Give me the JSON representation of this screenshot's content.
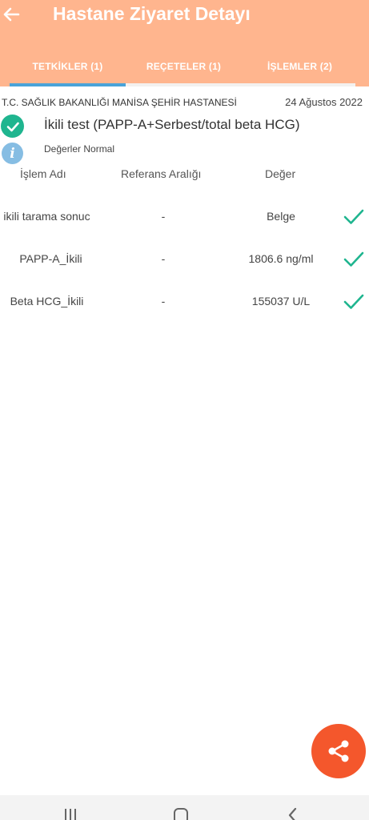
{
  "header": {
    "title": "Hastane Ziyaret Detayı",
    "back_icon": "arrow-left-icon",
    "background": "#ffb58e"
  },
  "tabs": [
    {
      "label": "TETKİKLER (1)",
      "active": true
    },
    {
      "label": "REÇETELER (1)",
      "active": false
    },
    {
      "label": "İŞLEMLER (2)",
      "active": false
    }
  ],
  "visit": {
    "hospital": "T.C. SAĞLIK BAKANLIĞI MANİSA ŞEHİR HASTANESİ",
    "date": "24 Ağustos 2022"
  },
  "test": {
    "name": "İkili test (PAPP-A+Serbest/total beta HCG)",
    "status": "Değerler Normal",
    "status_icon": "check-circle-icon",
    "info_icon": "info-icon"
  },
  "table": {
    "headers": [
      "İşlem Adı",
      "Referans Aralığı",
      "Değer"
    ],
    "rows": [
      {
        "name": "ikili tarama sonuc",
        "ref": "-",
        "value": "Belge"
      },
      {
        "name": "PAPP-A_İkili",
        "ref": "-",
        "value": "1806.6 ng/ml"
      },
      {
        "name": "Beta HCG_İkili",
        "ref": "-",
        "value": "155037 U/L"
      }
    ]
  },
  "fab": {
    "icon": "share-icon",
    "color": "#f4572c"
  },
  "nav": {
    "icons": [
      "recent-apps-icon",
      "home-icon",
      "back-icon"
    ]
  },
  "colors": {
    "accent": "#4aa3d8",
    "success": "#1fb58f",
    "info": "#86bde3"
  }
}
